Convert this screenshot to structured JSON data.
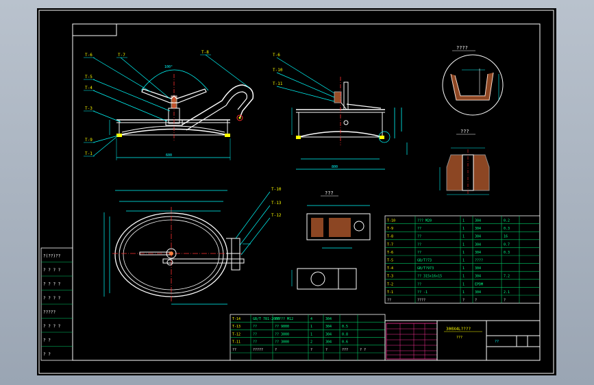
{
  "colors": {
    "background": "#000000",
    "viewport": "#a7b1be",
    "border": "#ffffff",
    "outline": "#ffffff",
    "dimension": "#00ffff",
    "hatch": "#ff8040",
    "centerline": "#ff3030",
    "table": "#00cc66",
    "label": "#ffff00",
    "titleblock": "#ff3399"
  },
  "labels": {
    "leaders_left": [
      "T-6",
      "T-7",
      "T-8",
      "T-5",
      "T-4",
      "T-3",
      "T-9",
      "T-1"
    ],
    "leaders_mid": [
      "T-6",
      "T-10",
      "T-11"
    ],
    "leaders_plan": [
      "T-10",
      "T-13",
      "T-12"
    ],
    "angle": "100°",
    "detail_title_1": "????",
    "detail_title_2": "???",
    "section_title": "???",
    "dim_plan_1": "600",
    "dim_plan_2": "800"
  },
  "left_legend": [
    "?(??)??",
    "? ? ? ?",
    "? ? ? ?",
    "? ? ? ?",
    "?????",
    "? ? ? ?",
    "?   ?",
    "?   ?"
  ],
  "parts_table_right": [
    [
      "T-10",
      "??? M20",
      "1",
      "304",
      "0.2",
      ""
    ],
    [
      "T-9",
      "??",
      "1",
      "304",
      "0.3",
      ""
    ],
    [
      "T-8",
      "??",
      "1",
      "304",
      "16",
      ""
    ],
    [
      "T-7",
      "??",
      "1",
      "304",
      "0.7",
      ""
    ],
    [
      "T-6",
      "??",
      "1",
      "304",
      "0.3",
      ""
    ],
    [
      "T-5",
      "GB/T?73",
      "1",
      "????",
      "",
      ""
    ],
    [
      "T-4",
      "GB/T?973",
      "1",
      "304",
      "",
      ""
    ],
    [
      "T-3",
      "?? 315x16x15",
      "1",
      "304",
      "7.2",
      ""
    ],
    [
      "T-2",
      "??",
      "1",
      "EPDM",
      "",
      ""
    ],
    [
      "T-1",
      "?? -1",
      "1",
      "304",
      "2.1",
      ""
    ]
  ],
  "parts_table_bottom": [
    [
      "T-14",
      "GB/T 781-2000",
      "????? M12",
      "4",
      "304",
      "",
      ""
    ],
    [
      "T-13",
      "??",
      "?? 9000",
      "1",
      "304",
      "0.5",
      ""
    ],
    [
      "T-12",
      "??",
      "?? 3000",
      "1",
      "304",
      "0.8",
      ""
    ],
    [
      "T-11",
      "??",
      "?? 3000",
      "2",
      "304",
      "0.6",
      ""
    ]
  ],
  "table_headers": {
    "right": [
      "??",
      "????",
      "?",
      "?",
      "?",
      ""
    ],
    "bottom": [
      "??",
      "?????",
      "?",
      "?",
      "?",
      "???",
      "? ?"
    ]
  },
  "title_block": {
    "title": "300X4L????",
    "subtitle": "???",
    "scale_label": "??"
  },
  "chart_data": {
    "type": "engineering drawing"
  }
}
